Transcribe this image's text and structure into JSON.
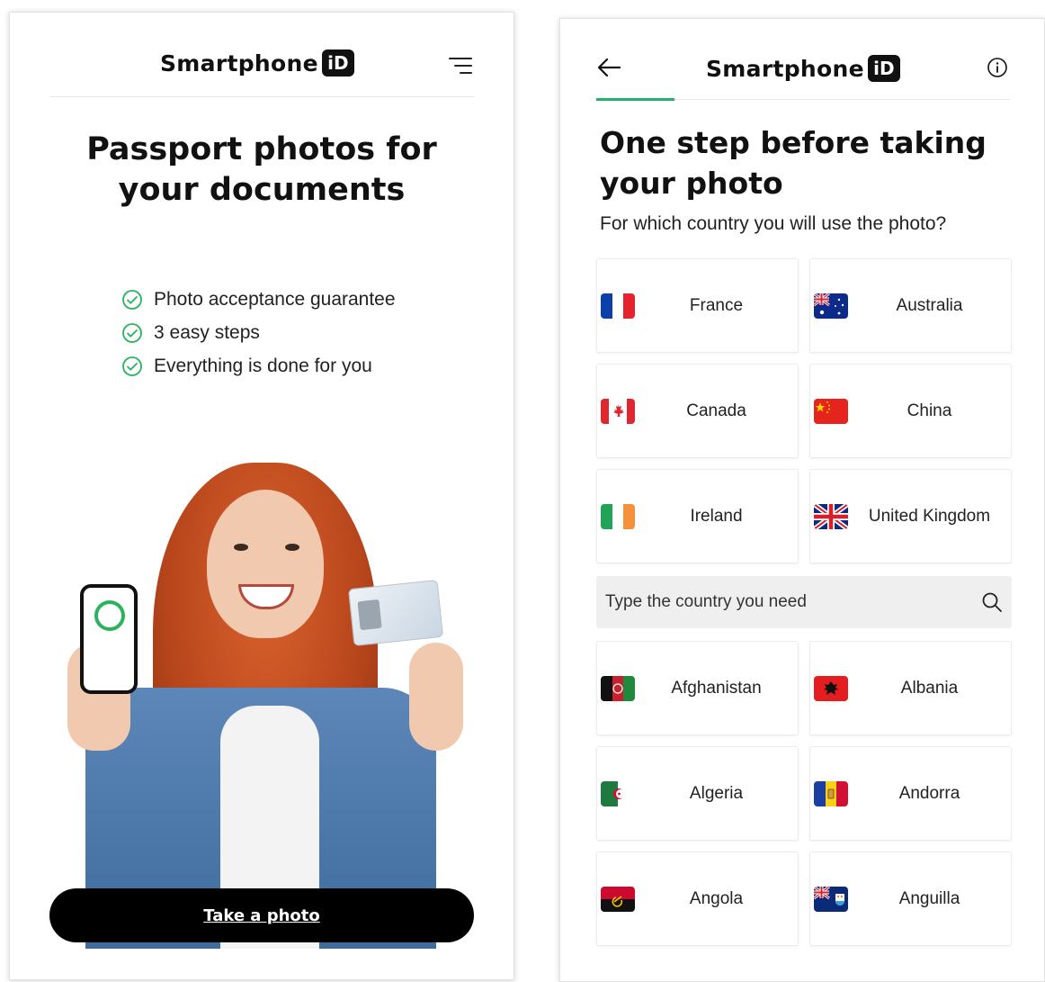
{
  "left_screen": {
    "brand": {
      "text": "Smartphone",
      "badge": "iD"
    },
    "title_line1": "Passport photos for",
    "title_line2": "your documents",
    "features": [
      "Photo acceptance guarantee",
      "3 easy steps",
      "Everything is done for you"
    ],
    "cta_label": "Take a photo"
  },
  "right_screen": {
    "brand": {
      "text": "Smartphone",
      "badge": "iD"
    },
    "progress_fraction": 0.19,
    "title_line1": "One step before taking",
    "title_line2": "your photo",
    "subtitle": "For which country you will use the photo?",
    "popular_countries": [
      {
        "name": "France",
        "flag": "france-flag"
      },
      {
        "name": "Australia",
        "flag": "australia-flag"
      },
      {
        "name": "Canada",
        "flag": "canada-flag"
      },
      {
        "name": "China",
        "flag": "china-flag"
      },
      {
        "name": "Ireland",
        "flag": "ireland-flag"
      },
      {
        "name": "United Kingdom",
        "flag": "united-kingdom-flag"
      }
    ],
    "search_placeholder": "Type the country you need",
    "all_countries": [
      {
        "name": "Afghanistan",
        "flag": "afghanistan-flag"
      },
      {
        "name": "Albania",
        "flag": "albania-flag"
      },
      {
        "name": "Algeria",
        "flag": "algeria-flag"
      },
      {
        "name": "Andorra",
        "flag": "andorra-flag"
      },
      {
        "name": "Angola",
        "flag": "angola-flag"
      },
      {
        "name": "Anguilla",
        "flag": "anguilla-flag"
      }
    ]
  },
  "colors": {
    "accent_green": "#23b26d",
    "check_green": "#2bb25c",
    "cta_background": "#000000",
    "search_background": "#efefef"
  }
}
